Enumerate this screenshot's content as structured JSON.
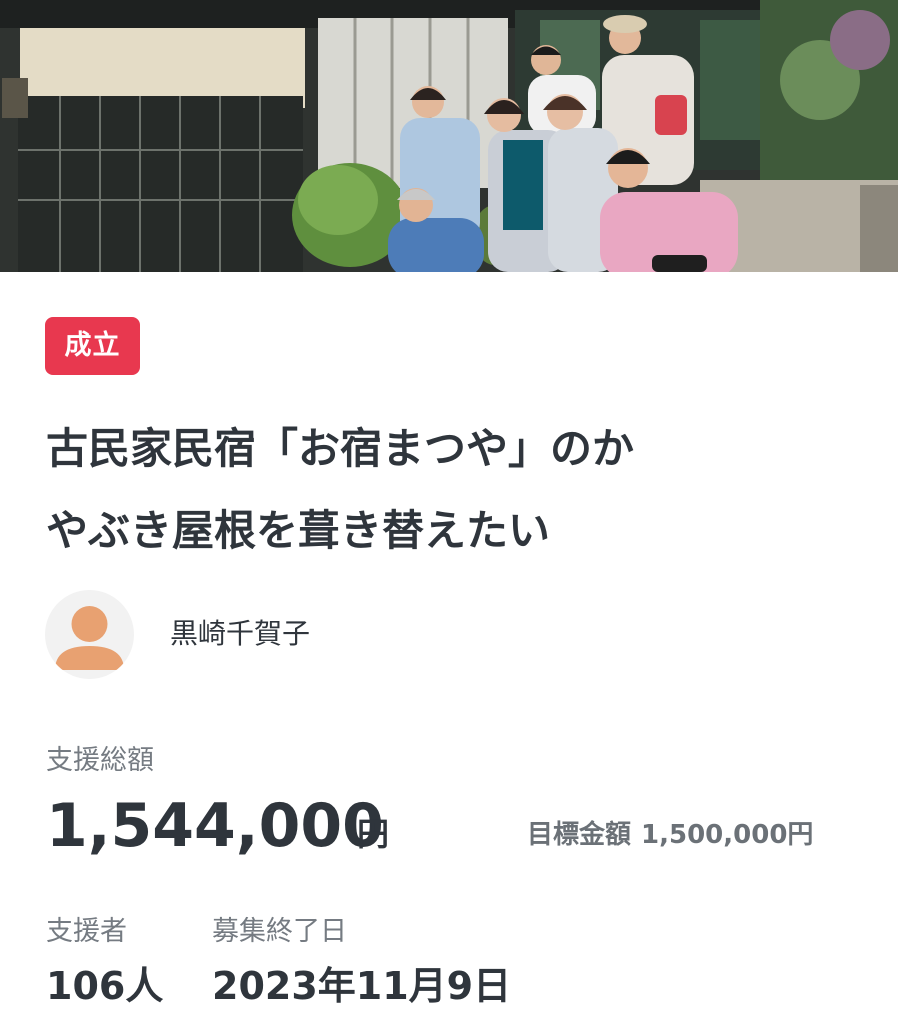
{
  "project": {
    "status_badge": "成立",
    "title_line1": "古民家民宿「お宿まつや」のか",
    "title_line2": "やぶき屋根を葺き替えたい"
  },
  "owner": {
    "name": "黒崎千賀子",
    "avatar_icon": "default-user-icon"
  },
  "funding": {
    "total_label": "支援総額",
    "total_amount": "1,544,000",
    "total_unit": "円",
    "goal_label": "目標金額",
    "goal_amount": "1,500,000円"
  },
  "supporters": {
    "label": "支援者",
    "value": "106人"
  },
  "deadline": {
    "label": "募集終了日",
    "value": "2023年11月9日"
  },
  "colors": {
    "badge_background": "#e8384f",
    "text_primary": "#2f353c",
    "text_secondary": "#757b82",
    "avatar_fill": "#e8a171"
  }
}
